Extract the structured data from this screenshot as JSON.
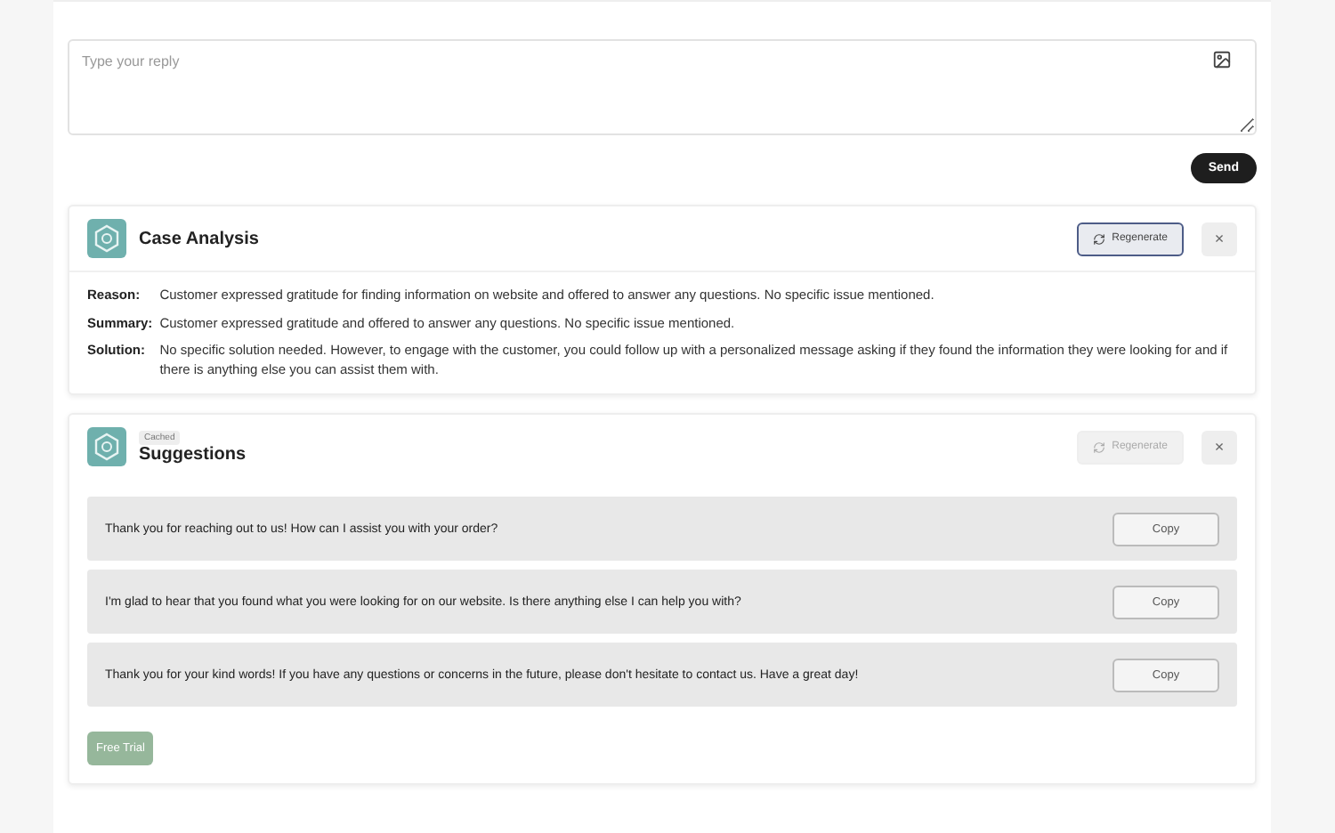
{
  "reply": {
    "placeholder": "Type your reply",
    "send": "Send"
  },
  "analysis": {
    "title": "Case Analysis",
    "regenerate": {
      "label": "Regenerate",
      "disabled": false
    },
    "close": "×",
    "rows": [
      {
        "label": "Reason:",
        "text": "Customer expressed gratitude for finding information on website and offered to answer any questions. No specific issue mentioned."
      },
      {
        "label": "Summary:",
        "text": "Customer expressed gratitude and offered to answer any questions. No specific issue mentioned."
      },
      {
        "label": "Solution:",
        "text": "No specific solution needed. However, to engage with the customer, you could follow up with a personalized message asking if they found the information they were looking for and if there is anything else you can assist them with."
      }
    ]
  },
  "suggestions": {
    "badge": "Cached",
    "title": "Suggestions",
    "regenerate": {
      "label": "Regenerate",
      "disabled": true
    },
    "close": "×",
    "items": [
      {
        "text": "Thank you for reaching out to us! How can I assist you with your order?",
        "copy": "Copy"
      },
      {
        "text": "I'm glad to hear that you found what you were looking for on our website. Is there anything else I can help you with?",
        "copy": "Copy"
      },
      {
        "text": "Thank you for your kind words! If you have any questions or concerns in the future, please don't hesitate to contact us. Have a great day!",
        "copy": "Copy"
      }
    ],
    "trial": "Free Trial"
  }
}
